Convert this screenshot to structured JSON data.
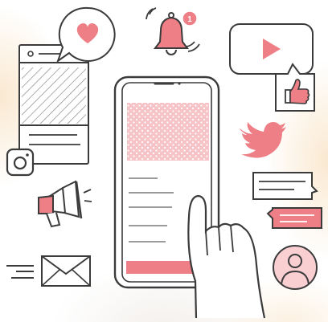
{
  "watermark_text": "",
  "notification": {
    "count": "1"
  },
  "colors": {
    "accent_pink": "#ee7f86",
    "light_pink": "#f9cfd2",
    "outline": "#3b3b3b",
    "background": "#ffffff"
  },
  "icons": [
    "heart-icon",
    "bell-icon",
    "youtube-play-icon",
    "thumbs-up-icon",
    "twitter-bird-icon",
    "instagram-camera-icon",
    "megaphone-icon",
    "mail-icon",
    "user-avatar-icon",
    "chat-bubble-icon",
    "smartphone-icon",
    "hand-icon"
  ]
}
